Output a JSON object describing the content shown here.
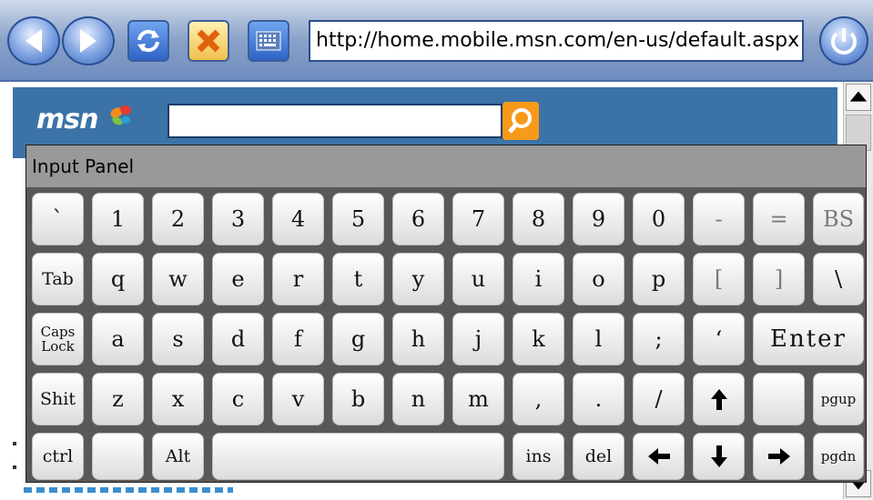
{
  "browser": {
    "address_url": "http://home.mobile.msn.com/en-us/default.aspx"
  },
  "msn": {
    "logo_text": "msn",
    "search_value": "",
    "accent_color": "#f79a1a",
    "bar_color": "#3c73a7"
  },
  "input_panel": {
    "title": "Input Panel",
    "rows": [
      [
        "`",
        "1",
        "2",
        "3",
        "4",
        "5",
        "6",
        "7",
        "8",
        "9",
        "0",
        "-",
        "=",
        "BS"
      ],
      [
        "Tab",
        "q",
        "w",
        "e",
        "r",
        "t",
        "y",
        "u",
        "i",
        "o",
        "p",
        "[",
        "]",
        "\\"
      ],
      [
        "Caps Lock",
        "a",
        "s",
        "d",
        "f",
        "g",
        "h",
        "j",
        "k",
        "l",
        ";",
        "‘",
        "Enter"
      ],
      [
        "Shit",
        "z",
        "x",
        "c",
        "v",
        "b",
        "n",
        "m",
        ",",
        ".",
        "/",
        "up-arrow-icon",
        "",
        "pgup"
      ],
      [
        "ctrl",
        "",
        "Alt",
        "space",
        "ins",
        "del",
        "left-arrow-icon",
        "down-arrow-icon",
        "right-arrow-icon",
        "pgdn"
      ]
    ]
  },
  "icons": [
    "back-icon",
    "forward-icon",
    "refresh-icon",
    "stop-icon",
    "keyboard-icon",
    "power-icon",
    "search-icon",
    "butterfly-icon"
  ]
}
